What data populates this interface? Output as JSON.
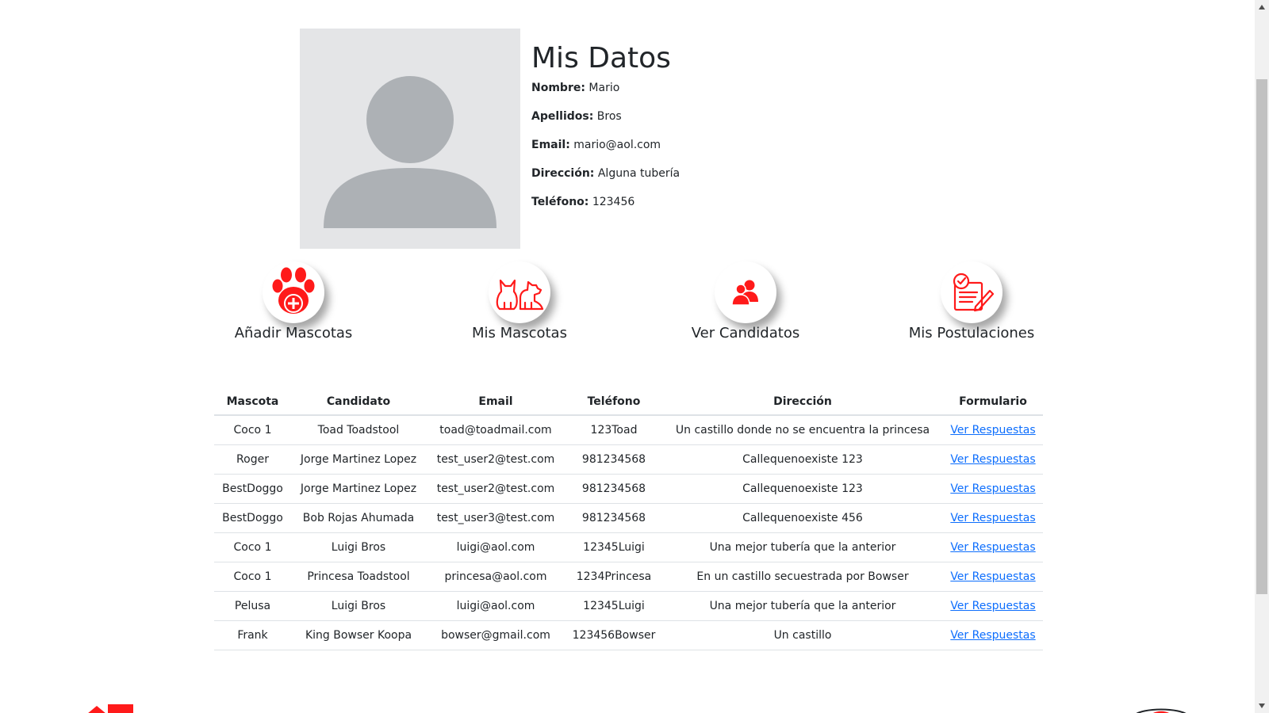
{
  "profile": {
    "title": "Mis Datos",
    "fields": [
      {
        "label": "Nombre:",
        "value": "Mario"
      },
      {
        "label": "Apellidos:",
        "value": "Bros"
      },
      {
        "label": "Email:",
        "value": "mario@aol.com"
      },
      {
        "label": "Dirección:",
        "value": "Alguna tubería"
      },
      {
        "label": "Teléfono:",
        "value": "123456"
      }
    ]
  },
  "actions": [
    {
      "label": "Añadir Mascotas",
      "icon": "paw-plus-icon"
    },
    {
      "label": "Mis Mascotas",
      "icon": "cat-dog-icon"
    },
    {
      "label": "Ver Candidatos",
      "icon": "users-icon"
    },
    {
      "label": "Mis Postulaciones",
      "icon": "checklist-pen-icon"
    }
  ],
  "table": {
    "headers": [
      "Mascota",
      "Candidato",
      "Email",
      "Teléfono",
      "Dirección",
      "Formulario"
    ],
    "link_label": "Ver Respuestas",
    "rows": [
      [
        "Coco 1",
        "Toad Toadstool",
        "toad@toadmail.com",
        "123Toad",
        "Un castillo donde no se encuentra la princesa"
      ],
      [
        "Roger",
        "Jorge Martinez Lopez",
        "test_user2@test.com",
        "981234568",
        "Callequenoexiste 123"
      ],
      [
        "BestDoggo",
        "Jorge Martinez Lopez",
        "test_user2@test.com",
        "981234568",
        "Callequenoexiste 123"
      ],
      [
        "BestDoggo",
        "Bob Rojas Ahumada",
        "test_user3@test.com",
        "981234568",
        "Callequenoexiste 456"
      ],
      [
        "Coco 1",
        "Luigi Bros",
        "luigi@aol.com",
        "12345Luigi",
        "Una mejor tubería que la anterior"
      ],
      [
        "Coco 1",
        "Princesa Toadstool",
        "princesa@aol.com",
        "1234Princesa",
        "En un castillo secuestrada por Bowser"
      ],
      [
        "Pelusa",
        "Luigi Bros",
        "luigi@aol.com",
        "12345Luigi",
        "Una mejor tubería que la anterior"
      ],
      [
        "Frank",
        "King Bowser Koopa",
        "bowser@gmail.com",
        "123456Bowser",
        "Un castillo"
      ]
    ]
  },
  "colors": {
    "accent": "#ff1a1a",
    "link": "#0d6efd",
    "avatar_bg": "#e4e5e7",
    "avatar_fg": "#adb1b5"
  }
}
